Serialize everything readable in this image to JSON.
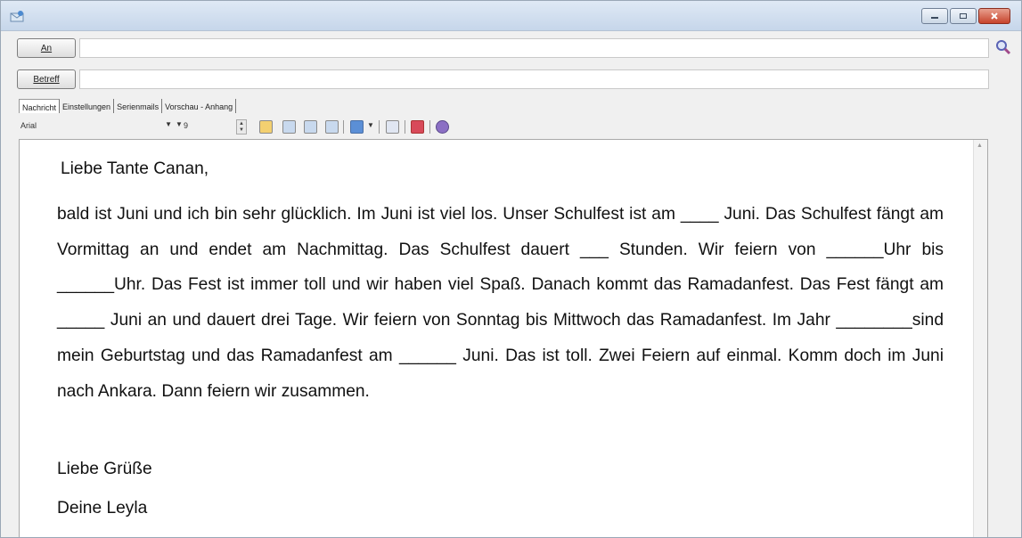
{
  "header": {
    "to_label": "An",
    "to_value": "",
    "subject_label": "Betreff",
    "subject_value": ""
  },
  "tabs": [
    {
      "label": "Nachricht",
      "active": true
    },
    {
      "label": "Einstellungen",
      "active": false
    },
    {
      "label": "Serienmails",
      "active": false
    },
    {
      "label": "Vorschau - Anhang",
      "active": false
    }
  ],
  "toolbar": {
    "font": "Arial",
    "size": "9"
  },
  "message": {
    "greeting": "Liebe Tante Canan,",
    "paragraph": "bald ist Juni und ich bin sehr glücklich. Im Juni ist viel los. Unser Schulfest ist am ____ Juni. Das Schulfest fängt am Vormittag an und endet am Nachmittag. Das Schulfest dauert ___ Stunden. Wir feiern von ______Uhr bis ______Uhr. Das Fest ist immer toll und wir haben viel Spaß. Danach kommt das Ramadanfest. Das Fest fängt am _____ Juni an und dauert drei Tage. Wir feiern von Sonntag bis Mittwoch das Ramadanfest. Im Jahr ________sind mein Geburtstag und das Ramadanfest am ______ Juni. Das ist toll. Zwei Feiern auf einmal. Komm doch im Juni nach Ankara. Dann feiern wir zusammen.",
    "closing_line1": "Liebe Grüße",
    "closing_line2": "Deine Leyla"
  },
  "colors": {
    "titlebar": "#c6d6ea",
    "close_button": "#c7432b",
    "window_bg": "#f0f0f0",
    "editor_bg": "#ffffff"
  }
}
